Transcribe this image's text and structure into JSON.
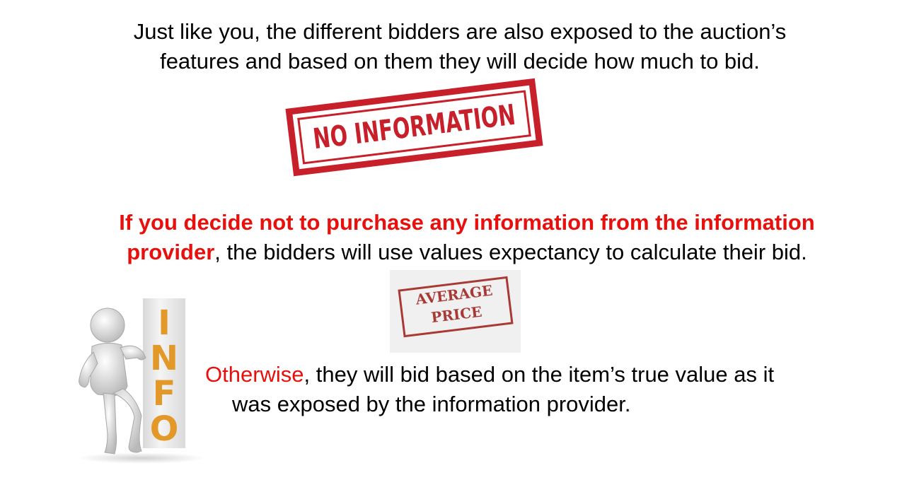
{
  "text1": {
    "line1": "Just like you, the different bidders are also exposed to the auction’s",
    "line2": "features and based on them they will decide how much to bid."
  },
  "stamp_no_information": "NO INFORMATION",
  "text2": {
    "part1_red": "If  you decide not to  purchase any information from the information",
    "part2_red": "provider",
    "part2_rest": ", the bidders will use values expectancy to calculate their bid."
  },
  "stamp_average_price": {
    "line1": "AVERAGE",
    "line2": "PRICE"
  },
  "info_figure": {
    "letters": [
      "I",
      "N",
      "F",
      "O"
    ]
  },
  "text3": {
    "red": "Otherwise",
    "rest": ", they will bid based on the item’s true value as it",
    "line2": "was exposed by the information provider."
  },
  "colors": {
    "accent_red": "#e8100c",
    "stamp_red": "#c8202a",
    "info_orange": "#e3982a"
  }
}
